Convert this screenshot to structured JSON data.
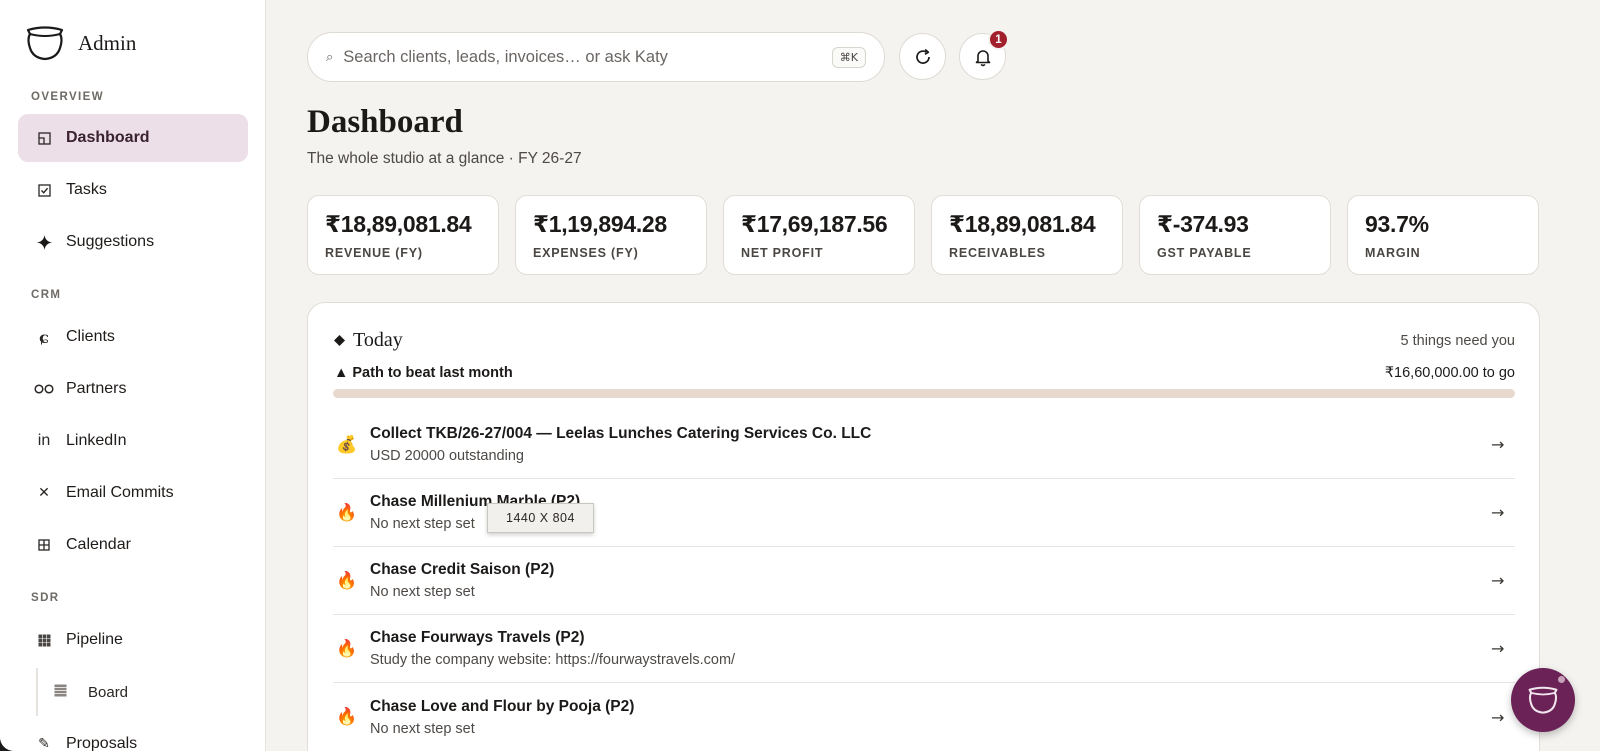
{
  "brand": {
    "name": "Admin"
  },
  "sidebar": {
    "sections": [
      {
        "label": "OVERVIEW"
      },
      {
        "label": "CRM"
      },
      {
        "label": "SDR"
      }
    ],
    "items": [
      {
        "label": "Dashboard",
        "icon": "dashboard-icon"
      },
      {
        "label": "Tasks",
        "icon": "checkbox-icon"
      },
      {
        "label": "Suggestions",
        "icon": "sparkle-icon"
      },
      {
        "label": "Clients",
        "icon": "client-icon"
      },
      {
        "label": "Partners",
        "icon": "partners-icon"
      },
      {
        "label": "LinkedIn",
        "icon": "linkedin-icon"
      },
      {
        "label": "Email Commits",
        "icon": "x-icon"
      },
      {
        "label": "Calendar",
        "icon": "grid-icon"
      },
      {
        "label": "Pipeline",
        "icon": "pipeline-icon"
      },
      {
        "label": "Board",
        "icon": "board-icon"
      },
      {
        "label": "Proposals",
        "icon": "pencil-icon"
      }
    ]
  },
  "search": {
    "placeholder": "Search clients, leads, invoices… or ask Katy",
    "shortcut": "⌘K"
  },
  "notifications": {
    "count": "1"
  },
  "header": {
    "title": "Dashboard",
    "subtitle": "The whole studio at a glance · FY 26-27"
  },
  "kpis": [
    {
      "value": "₹18,89,081.84",
      "label": "REVENUE (FY)"
    },
    {
      "value": "₹1,19,894.28",
      "label": "EXPENSES (FY)"
    },
    {
      "value": "₹17,69,187.56",
      "label": "NET PROFIT"
    },
    {
      "value": "₹18,89,081.84",
      "label": "RECEIVABLES"
    },
    {
      "value": "₹-374.93",
      "label": "GST PAYABLE"
    },
    {
      "value": "93.7%",
      "label": "MARGIN"
    }
  ],
  "today": {
    "title": "Today",
    "count": "5 things need you",
    "path_label": "▲ Path to beat last month",
    "path_togo": "₹16,60,000.00 to go",
    "path_progress": 0,
    "items": [
      {
        "emoji": "💰",
        "title": "Collect TKB/26-27/004 — Leelas Lunches Catering Services Co. LLC",
        "sub": "USD 20000 outstanding"
      },
      {
        "emoji": "🔥",
        "title": "Chase Millenium Marble (P2)",
        "sub": "No next step set"
      },
      {
        "emoji": "🔥",
        "title": "Chase Credit Saison (P2)",
        "sub": "No next step set"
      },
      {
        "emoji": "🔥",
        "title": "Chase Fourways Travels (P2)",
        "sub": "Study the company website: https://fourwaystravels.com/"
      },
      {
        "emoji": "🔥",
        "title": "Chase Love and Flour by Pooja (P2)",
        "sub": "No next step set"
      }
    ]
  },
  "tooltip": {
    "text": "1440 X 804"
  },
  "colors": {
    "accent": "#6b2256",
    "active_bg": "#eddfe8",
    "badge": "#a1202c",
    "bar_track": "#e8d9cf"
  }
}
